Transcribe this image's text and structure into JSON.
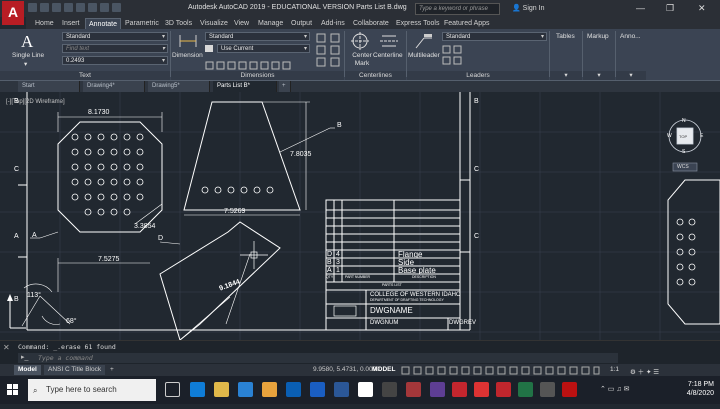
{
  "titlebar": {
    "title": "Autodesk AutoCAD 2019 - EDUCATIONAL VERSION      Parts List B.dwg",
    "search_placeholder": "Type a keyword or phrase",
    "user": "Sign In",
    "logo": "A"
  },
  "menu": [
    "Home",
    "Insert",
    "Annotate",
    "Parametric",
    "3D Tools",
    "Visualize",
    "View",
    "Manage",
    "Output",
    "Add-ins",
    "Collaborate",
    "Express Tools",
    "Featured Apps"
  ],
  "active_menu": "Annotate",
  "ribbon": {
    "text": {
      "big": "Single Line",
      "style": "Standard",
      "find": "Find text",
      "height": "0.2493",
      "label": "Text"
    },
    "dimensions": {
      "big": "Dimension",
      "style": "Standard",
      "layer": "Use Current",
      "label": "Dimensions"
    },
    "centerlines": {
      "center_mark": "Center Mark",
      "centerline": "Centerline",
      "label": "Centerlines"
    },
    "leaders": {
      "multileader": "Multileader",
      "style": "Standard",
      "label": "Leaders"
    },
    "tables": "Tables",
    "markup": "Markup",
    "anno": "Anno..."
  },
  "file_tabs": [
    "Start",
    "Drawing4*",
    "Drawing5*",
    "Parts List B*"
  ],
  "active_file_tab": "Parts List B*",
  "viewport_label": "[-][Top][2D Wireframe]",
  "drawing": {
    "dims": [
      "8.1730",
      "3.3854",
      "7.5275",
      "9.1844",
      "7.5269",
      "7.8035"
    ],
    "angles": [
      "113°",
      "68°"
    ],
    "callouts": [
      "A",
      "B",
      "C",
      "D"
    ],
    "border_letters": [
      "B",
      "C",
      "A",
      "B",
      "C",
      "B"
    ],
    "title_block": {
      "college": "COLLEGE OF WESTERN IDAHO",
      "subtitle": "DEPARTMENT OF DRAFTING TECHNOLOGY",
      "dwgname": "DWGNAME",
      "dwgnum": "DWGNUM",
      "dwgrev": "DWGREV",
      "parts_list": "PARTS LIST",
      "part_col": "PART NUMBER",
      "desc_col": "DESCRIPTION",
      "qty_col": "QTY",
      "rows": [
        {
          "item": "D",
          "qty": "4",
          "desc": "Flange"
        },
        {
          "item": "B",
          "qty": "3",
          "desc": "Side"
        },
        {
          "item": "A",
          "qty": "1",
          "desc": "Base plate"
        }
      ]
    },
    "viewcube": {
      "face": "TOP",
      "n": "N",
      "s": "S",
      "e": "E",
      "w": "W",
      "wcs": "WCS"
    }
  },
  "command": {
    "history": "Command: _.erase 61 found",
    "placeholder": "Type a command"
  },
  "layout_tabs": [
    "Model",
    "ANSI C Title Block"
  ],
  "status": {
    "coords": "9.9580, 5.4731, 0.0000",
    "mode": "MODEL",
    "scale": "1:1"
  },
  "taskbar": {
    "search": "Type here to search",
    "time": "7:18 PM",
    "date": "4/8/2020"
  },
  "colors": {
    "accent": "#b81d24",
    "canvas": "#212830",
    "lines": "#ffffff",
    "grid": "#2c3440"
  }
}
